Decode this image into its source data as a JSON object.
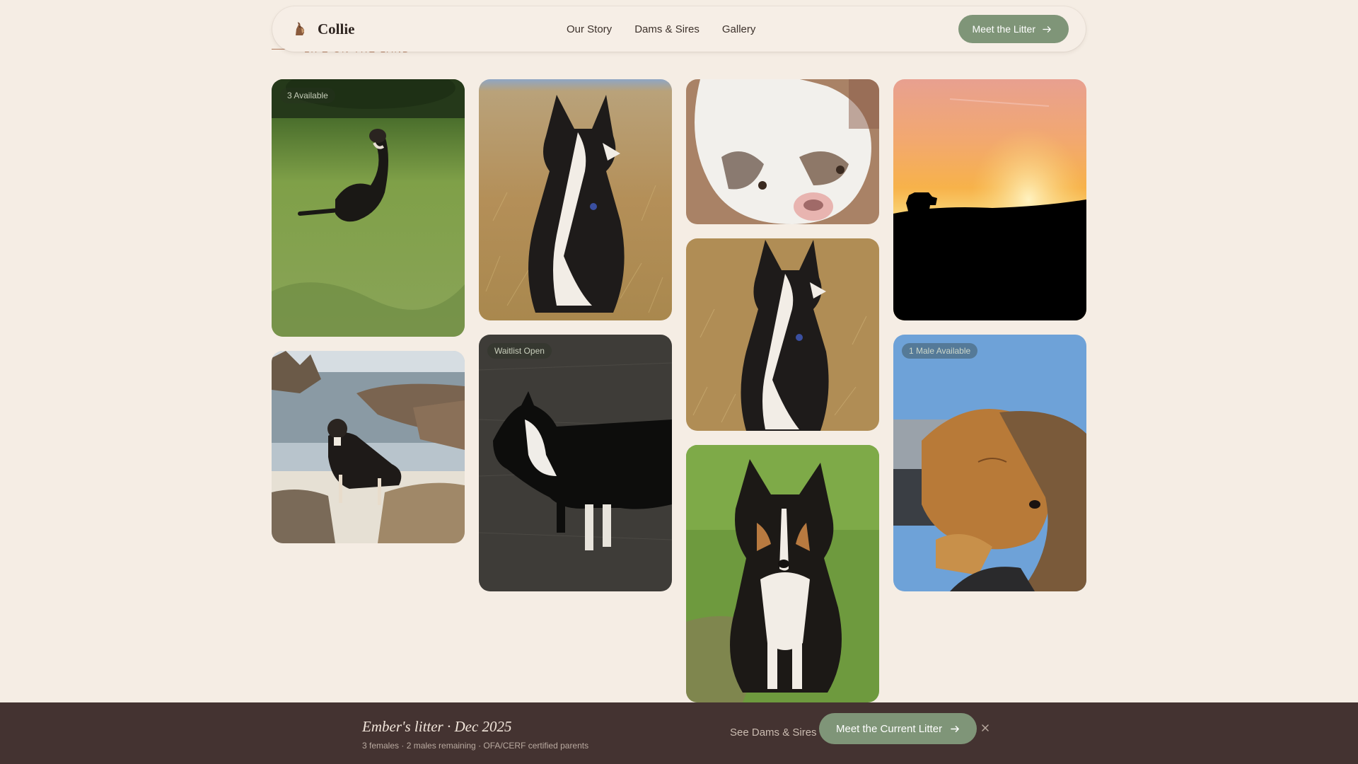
{
  "header": {
    "brand": "Collie",
    "brand_icon": "dog-icon",
    "nav": [
      "Our Story",
      "Dams & Sires",
      "Gallery"
    ],
    "cta_label": "Meet the Litter",
    "cta_icon": "arrow-right-icon"
  },
  "section": {
    "eyebrow": "Life on the Land"
  },
  "gallery": {
    "badges": {
      "first": "3 Available",
      "fourth": "Waitlist Open",
      "eighth": "1 Male Available"
    }
  },
  "bottom_bar": {
    "title": "Ember's litter · Dec 2025",
    "subtitle": "3 females · 2 males remaining · OFA/CERF certified parents",
    "link_label": "See Dams & Sires",
    "cta_label": "Meet the Current Litter",
    "close_icon": "close-icon"
  },
  "colors": {
    "page_bg": "#f5ede4",
    "sage_accent": "#7f9578",
    "bar_bg": "#443331",
    "accent_rust": "#b07a5c"
  }
}
